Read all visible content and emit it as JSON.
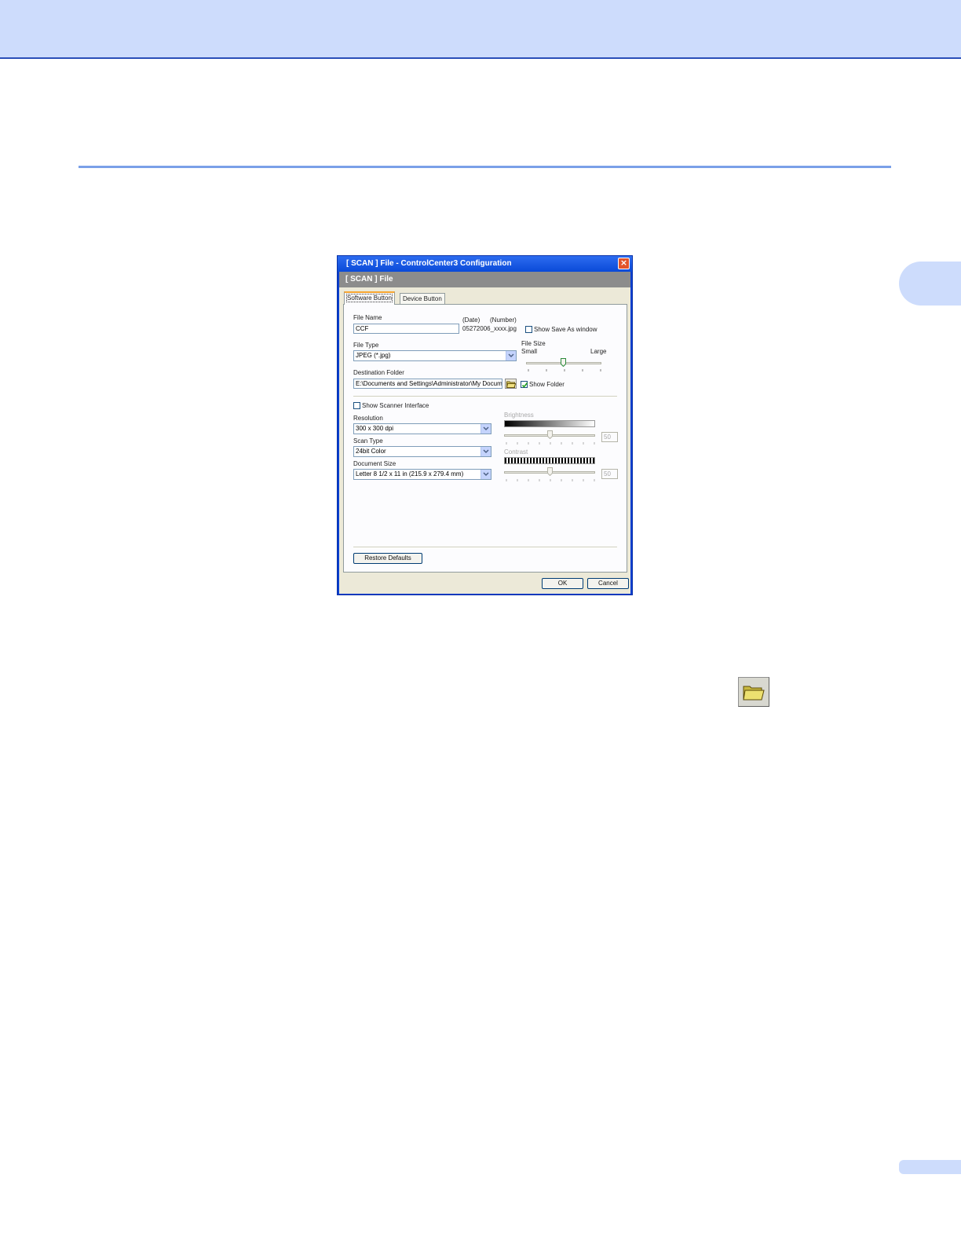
{
  "dialog": {
    "title": "[ SCAN ]  File - ControlCenter3 Configuration",
    "banner": "[ SCAN ]  File",
    "tabs": [
      {
        "label": "Software Button",
        "active": true
      },
      {
        "label": "Device Button",
        "active": false
      }
    ],
    "file_name": {
      "label": "File Name",
      "value": "CCF",
      "date_label": "(Date)",
      "number_label": "(Number)",
      "preview": "05272006_xxxx.jpg"
    },
    "show_save_as": {
      "label": "Show Save As window",
      "checked": false
    },
    "file_type": {
      "label": "File Type",
      "value": "JPEG (*.jpg)"
    },
    "file_size": {
      "label": "File Size",
      "small": "Small",
      "large": "Large"
    },
    "destination": {
      "label": "Destination Folder",
      "value": "E:\\Documents and Settings\\Administrator\\My Docume",
      "show_folder": {
        "label": "Show Folder",
        "checked": true
      }
    },
    "show_scanner_interface": {
      "label": "Show Scanner Interface",
      "checked": false
    },
    "resolution": {
      "label": "Resolution",
      "value": "300 x 300 dpi"
    },
    "scan_type": {
      "label": "Scan Type",
      "value": "24bit Color"
    },
    "document_size": {
      "label": "Document Size",
      "value": "Letter 8 1/2 x 11 in (215.9 x 279.4 mm)"
    },
    "brightness": {
      "label": "Brightness",
      "value": "50"
    },
    "contrast": {
      "label": "Contrast",
      "value": "50"
    },
    "restore_defaults": "Restore Defaults",
    "ok": "OK",
    "cancel": "Cancel",
    "close": "×"
  },
  "colors": {
    "header_band": "#cddcfc",
    "header_line": "#2a4fb8",
    "section_rule": "#7aa0e8",
    "titlebar": "#0a4ad8"
  },
  "icons": {
    "folder": "folder-icon",
    "close": "close-icon",
    "dropdown": "chevron-down-icon"
  }
}
